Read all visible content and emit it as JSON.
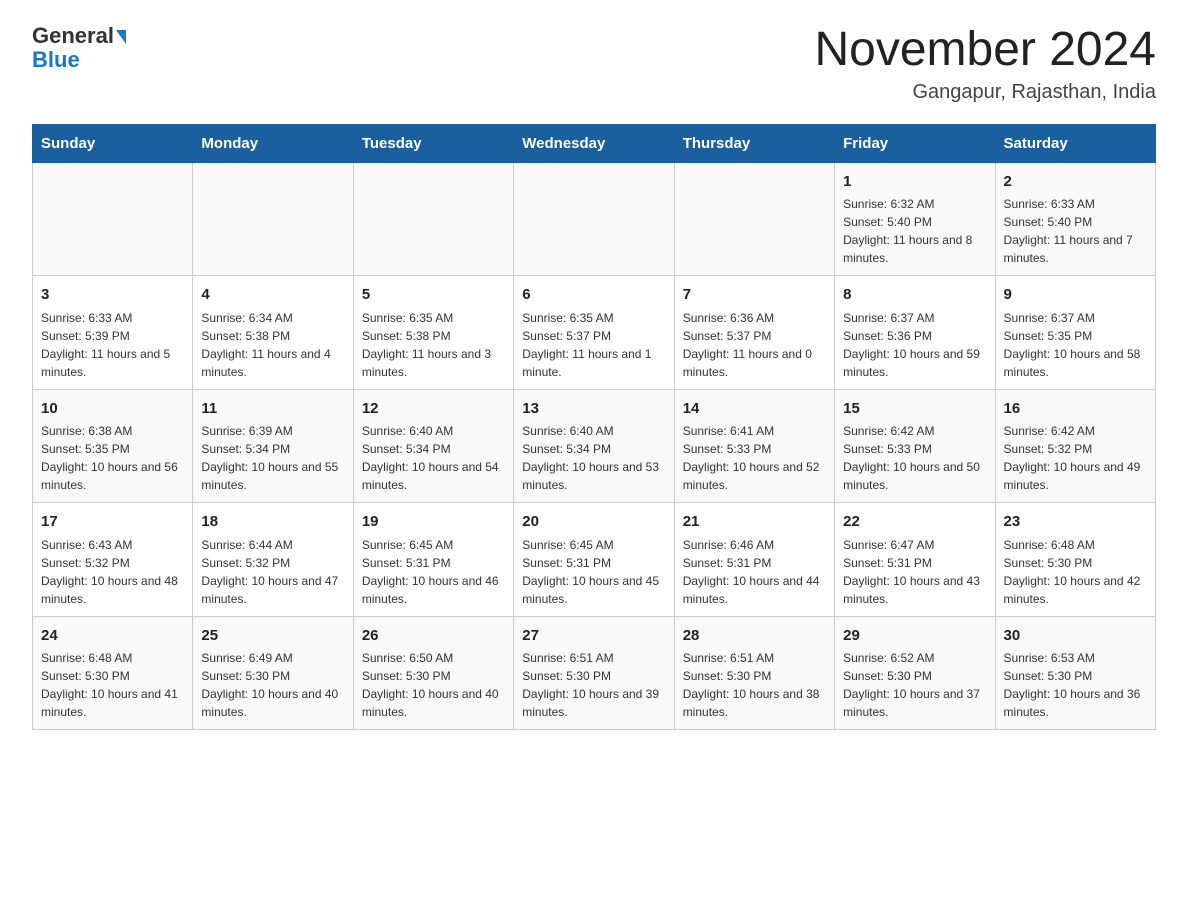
{
  "header": {
    "logo_line1": "General",
    "logo_line2": "Blue",
    "title": "November 2024",
    "subtitle": "Gangapur, Rajasthan, India"
  },
  "weekdays": [
    "Sunday",
    "Monday",
    "Tuesday",
    "Wednesday",
    "Thursday",
    "Friday",
    "Saturday"
  ],
  "weeks": [
    [
      {
        "day": "",
        "info": ""
      },
      {
        "day": "",
        "info": ""
      },
      {
        "day": "",
        "info": ""
      },
      {
        "day": "",
        "info": ""
      },
      {
        "day": "",
        "info": ""
      },
      {
        "day": "1",
        "info": "Sunrise: 6:32 AM\nSunset: 5:40 PM\nDaylight: 11 hours and 8 minutes."
      },
      {
        "day": "2",
        "info": "Sunrise: 6:33 AM\nSunset: 5:40 PM\nDaylight: 11 hours and 7 minutes."
      }
    ],
    [
      {
        "day": "3",
        "info": "Sunrise: 6:33 AM\nSunset: 5:39 PM\nDaylight: 11 hours and 5 minutes."
      },
      {
        "day": "4",
        "info": "Sunrise: 6:34 AM\nSunset: 5:38 PM\nDaylight: 11 hours and 4 minutes."
      },
      {
        "day": "5",
        "info": "Sunrise: 6:35 AM\nSunset: 5:38 PM\nDaylight: 11 hours and 3 minutes."
      },
      {
        "day": "6",
        "info": "Sunrise: 6:35 AM\nSunset: 5:37 PM\nDaylight: 11 hours and 1 minute."
      },
      {
        "day": "7",
        "info": "Sunrise: 6:36 AM\nSunset: 5:37 PM\nDaylight: 11 hours and 0 minutes."
      },
      {
        "day": "8",
        "info": "Sunrise: 6:37 AM\nSunset: 5:36 PM\nDaylight: 10 hours and 59 minutes."
      },
      {
        "day": "9",
        "info": "Sunrise: 6:37 AM\nSunset: 5:35 PM\nDaylight: 10 hours and 58 minutes."
      }
    ],
    [
      {
        "day": "10",
        "info": "Sunrise: 6:38 AM\nSunset: 5:35 PM\nDaylight: 10 hours and 56 minutes."
      },
      {
        "day": "11",
        "info": "Sunrise: 6:39 AM\nSunset: 5:34 PM\nDaylight: 10 hours and 55 minutes."
      },
      {
        "day": "12",
        "info": "Sunrise: 6:40 AM\nSunset: 5:34 PM\nDaylight: 10 hours and 54 minutes."
      },
      {
        "day": "13",
        "info": "Sunrise: 6:40 AM\nSunset: 5:34 PM\nDaylight: 10 hours and 53 minutes."
      },
      {
        "day": "14",
        "info": "Sunrise: 6:41 AM\nSunset: 5:33 PM\nDaylight: 10 hours and 52 minutes."
      },
      {
        "day": "15",
        "info": "Sunrise: 6:42 AM\nSunset: 5:33 PM\nDaylight: 10 hours and 50 minutes."
      },
      {
        "day": "16",
        "info": "Sunrise: 6:42 AM\nSunset: 5:32 PM\nDaylight: 10 hours and 49 minutes."
      }
    ],
    [
      {
        "day": "17",
        "info": "Sunrise: 6:43 AM\nSunset: 5:32 PM\nDaylight: 10 hours and 48 minutes."
      },
      {
        "day": "18",
        "info": "Sunrise: 6:44 AM\nSunset: 5:32 PM\nDaylight: 10 hours and 47 minutes."
      },
      {
        "day": "19",
        "info": "Sunrise: 6:45 AM\nSunset: 5:31 PM\nDaylight: 10 hours and 46 minutes."
      },
      {
        "day": "20",
        "info": "Sunrise: 6:45 AM\nSunset: 5:31 PM\nDaylight: 10 hours and 45 minutes."
      },
      {
        "day": "21",
        "info": "Sunrise: 6:46 AM\nSunset: 5:31 PM\nDaylight: 10 hours and 44 minutes."
      },
      {
        "day": "22",
        "info": "Sunrise: 6:47 AM\nSunset: 5:31 PM\nDaylight: 10 hours and 43 minutes."
      },
      {
        "day": "23",
        "info": "Sunrise: 6:48 AM\nSunset: 5:30 PM\nDaylight: 10 hours and 42 minutes."
      }
    ],
    [
      {
        "day": "24",
        "info": "Sunrise: 6:48 AM\nSunset: 5:30 PM\nDaylight: 10 hours and 41 minutes."
      },
      {
        "day": "25",
        "info": "Sunrise: 6:49 AM\nSunset: 5:30 PM\nDaylight: 10 hours and 40 minutes."
      },
      {
        "day": "26",
        "info": "Sunrise: 6:50 AM\nSunset: 5:30 PM\nDaylight: 10 hours and 40 minutes."
      },
      {
        "day": "27",
        "info": "Sunrise: 6:51 AM\nSunset: 5:30 PM\nDaylight: 10 hours and 39 minutes."
      },
      {
        "day": "28",
        "info": "Sunrise: 6:51 AM\nSunset: 5:30 PM\nDaylight: 10 hours and 38 minutes."
      },
      {
        "day": "29",
        "info": "Sunrise: 6:52 AM\nSunset: 5:30 PM\nDaylight: 10 hours and 37 minutes."
      },
      {
        "day": "30",
        "info": "Sunrise: 6:53 AM\nSunset: 5:30 PM\nDaylight: 10 hours and 36 minutes."
      }
    ]
  ]
}
